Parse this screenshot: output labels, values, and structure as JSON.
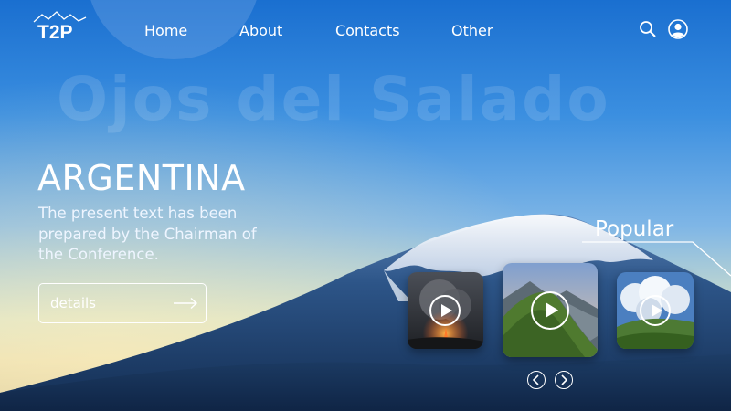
{
  "logo": {
    "text": "T2P"
  },
  "nav": {
    "items": [
      {
        "label": "Home"
      },
      {
        "label": "About"
      },
      {
        "label": "Contacts"
      },
      {
        "label": "Other"
      }
    ]
  },
  "header_icons": [
    "search-icon",
    "user-icon"
  ],
  "background_title": "Ojos del Salado",
  "hero": {
    "title": "ARGENTINA",
    "text": "The present text has been prepared by the Chairman of the Conference.",
    "button_label": "details"
  },
  "popular": {
    "label": "Popular",
    "cards": [
      {
        "scene": "volcano-eruption"
      },
      {
        "scene": "green-volcano"
      },
      {
        "scene": "clouds-hills"
      }
    ]
  },
  "colors": {
    "text": "#ffffff",
    "sky_top": "#1a6fd0",
    "horizon": "#e9ddb0",
    "mountain": "#1f4470"
  }
}
